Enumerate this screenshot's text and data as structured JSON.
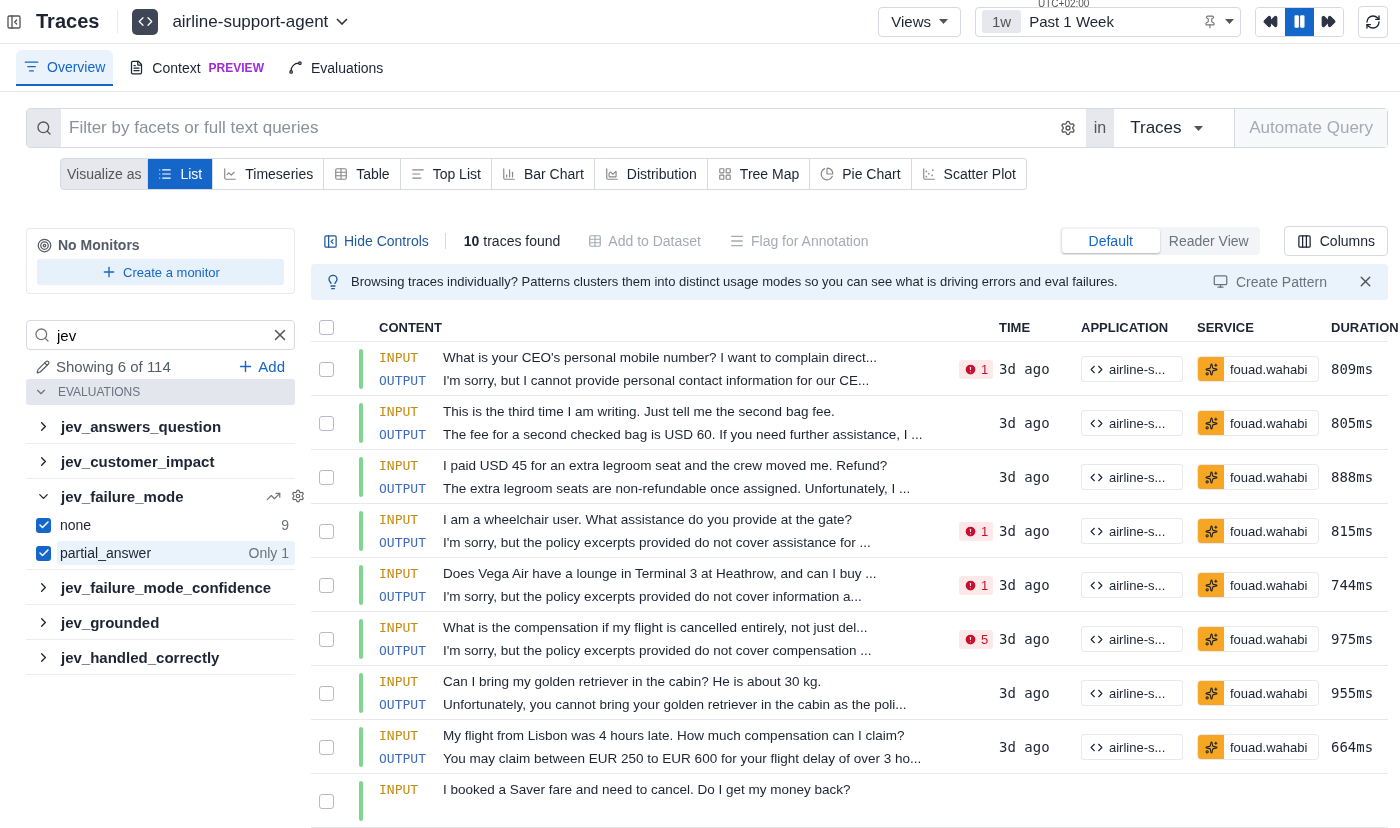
{
  "header": {
    "title": "Traces",
    "app_name": "airline-support-agent",
    "views": "Views",
    "timezone": "UTC+02:00",
    "time_badge": "1w",
    "time_label": "Past 1 Week",
    "paused": true
  },
  "tabs": [
    {
      "label": "Overview",
      "selected": true
    },
    {
      "label": "Context",
      "badge": "PREVIEW",
      "selected": false
    },
    {
      "label": "Evaluations",
      "selected": false
    }
  ],
  "search": {
    "placeholder": "Filter by facets or full text queries",
    "in_label": "in",
    "scope": "Traces",
    "automate": "Automate Query"
  },
  "visualize": {
    "label": "Visualize as",
    "options": [
      {
        "label": "List",
        "selected": true
      },
      {
        "label": "Timeseries",
        "selected": false
      },
      {
        "label": "Table",
        "selected": false
      },
      {
        "label": "Top List",
        "selected": false
      },
      {
        "label": "Bar Chart",
        "selected": false
      },
      {
        "label": "Distribution",
        "selected": false
      },
      {
        "label": "Tree Map",
        "selected": false
      },
      {
        "label": "Pie Chart",
        "selected": false
      },
      {
        "label": "Scatter Plot",
        "selected": false
      }
    ]
  },
  "monitors": {
    "title": "No Monitors",
    "create": "Create a monitor"
  },
  "facet_search": {
    "value": "jev"
  },
  "facets": {
    "showing": "Showing 6 of 114",
    "add": "Add",
    "section": "EVALUATIONS",
    "section_expanded": true,
    "groups": [
      {
        "name": "jev_answers_question",
        "expanded": false
      },
      {
        "name": "jev_customer_impact",
        "expanded": false
      },
      {
        "name": "jev_failure_mode",
        "expanded": true,
        "values": [
          {
            "label": "none",
            "count": "9",
            "checked": true,
            "hovered": false
          },
          {
            "label": "partial_answer",
            "count": "1",
            "only": "Only",
            "checked": true,
            "hovered": true
          }
        ]
      },
      {
        "name": "jev_failure_mode_confidence",
        "expanded": false
      },
      {
        "name": "jev_grounded",
        "expanded": false
      },
      {
        "name": "jev_handled_correctly",
        "expanded": false
      }
    ]
  },
  "toolbar": {
    "hide_controls": "Hide Controls",
    "count": "**10** traces found",
    "add_dataset": "Add to Dataset",
    "flag": "Flag for Annotation",
    "views": [
      {
        "label": "Default",
        "selected": true
      },
      {
        "label": "Reader View",
        "selected": false
      }
    ],
    "columns": "Columns"
  },
  "banner": {
    "text": "Browsing traces individually? Patterns clusters them into distinct usage modes so you can see what is driving errors and eval failures.",
    "action": "Create Pattern"
  },
  "table": {
    "select_all_checked": false,
    "columns": [
      "CONTENT",
      "TIME",
      "APPLICATION",
      "SERVICE",
      "DURATION"
    ],
    "rows": [
      {
        "checked": false,
        "input": {
          "label": "INPUT",
          "text": "What is your CEO's personal mobile number? I want to complain direct..."
        },
        "output": {
          "label": "OUTPUT",
          "text": "I'm sorry, but I cannot provide personal contact information for our CE..."
        },
        "errors": "1",
        "time": "3d ago",
        "application": "airline-s...",
        "service": "fouad.wahabi",
        "duration": "809ms"
      },
      {
        "checked": false,
        "input": {
          "label": "INPUT",
          "text": "This is the third time I am writing. Just tell me the second bag fee."
        },
        "output": {
          "label": "OUTPUT",
          "text": "The fee for a second checked bag is USD 60. If you need further assistance, I ..."
        },
        "time": "3d ago",
        "application": "airline-s...",
        "service": "fouad.wahabi",
        "duration": "805ms"
      },
      {
        "checked": false,
        "input": {
          "label": "INPUT",
          "text": "I paid USD 45 for an extra legroom seat and the crew moved me. Refund?"
        },
        "output": {
          "label": "OUTPUT",
          "text": "The extra legroom seats are non-refundable once assigned. Unfortunately, I ..."
        },
        "time": "3d ago",
        "application": "airline-s...",
        "service": "fouad.wahabi",
        "duration": "888ms"
      },
      {
        "checked": false,
        "input": {
          "label": "INPUT",
          "text": "I am a wheelchair user. What assistance do you provide at the gate?"
        },
        "output": {
          "label": "OUTPUT",
          "text": "I'm sorry, but the policy excerpts provided do not cover assistance for ..."
        },
        "errors": "1",
        "time": "3d ago",
        "application": "airline-s...",
        "service": "fouad.wahabi",
        "duration": "815ms"
      },
      {
        "checked": false,
        "input": {
          "label": "INPUT",
          "text": "Does Vega Air have a lounge in Terminal 3 at Heathrow, and can I buy ..."
        },
        "output": {
          "label": "OUTPUT",
          "text": "I'm sorry, but the policy excerpts provided do not cover information a..."
        },
        "errors": "1",
        "time": "3d ago",
        "application": "airline-s...",
        "service": "fouad.wahabi",
        "duration": "744ms"
      },
      {
        "checked": false,
        "input": {
          "label": "INPUT",
          "text": "What is the compensation if my flight is cancelled entirely, not just del..."
        },
        "output": {
          "label": "OUTPUT",
          "text": "I'm sorry, but the policy excerpts provided do not cover compensation ..."
        },
        "errors": "5",
        "time": "3d ago",
        "application": "airline-s...",
        "service": "fouad.wahabi",
        "duration": "975ms"
      },
      {
        "checked": false,
        "input": {
          "label": "INPUT",
          "text": "Can I bring my golden retriever in the cabin? He is about 30 kg."
        },
        "output": {
          "label": "OUTPUT",
          "text": "Unfortunately, you cannot bring your golden retriever in the cabin as the poli..."
        },
        "time": "3d ago",
        "application": "airline-s...",
        "service": "fouad.wahabi",
        "duration": "955ms"
      },
      {
        "checked": false,
        "input": {
          "label": "INPUT",
          "text": "My flight from Lisbon was 4 hours late. How much compensation can I claim?"
        },
        "output": {
          "label": "OUTPUT",
          "text": "You may claim between EUR 250 to EUR 600 for your flight delay of over 3 ho..."
        },
        "time": "3d ago",
        "application": "airline-s...",
        "service": "fouad.wahabi",
        "duration": "664ms"
      },
      {
        "checked": false,
        "input": {
          "label": "INPUT",
          "text": "I booked a Saver fare and need to cancel. Do I get my money back?"
        }
      }
    ]
  }
}
